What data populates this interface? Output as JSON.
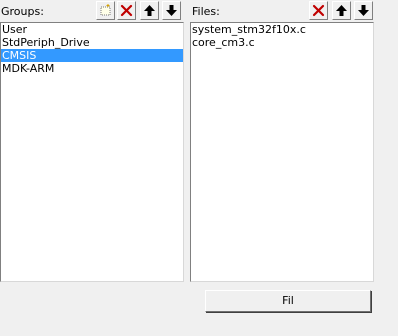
{
  "groups": {
    "label": "Groups:",
    "items": [
      "User",
      "StdPeriph_Drive",
      "CMSIS",
      "MDK-ARM"
    ],
    "selected_index": 2,
    "toolbar": {
      "new_icon": "new-item-icon",
      "delete_icon": "delete-x-icon",
      "move_up_icon": "arrow-up-icon",
      "move_down_icon": "arrow-down-icon"
    }
  },
  "files": {
    "label": "Files:",
    "items": [
      "system_stm32f10x.c",
      "core_cm3.c"
    ],
    "toolbar": {
      "delete_icon": "delete-x-icon",
      "move_up_icon": "arrow-up-icon",
      "move_down_icon": "arrow-down-icon"
    }
  },
  "add_files_button": {
    "label": "Fil"
  },
  "colors": {
    "selection": "#3399ff",
    "delete_red": "#c00000"
  }
}
